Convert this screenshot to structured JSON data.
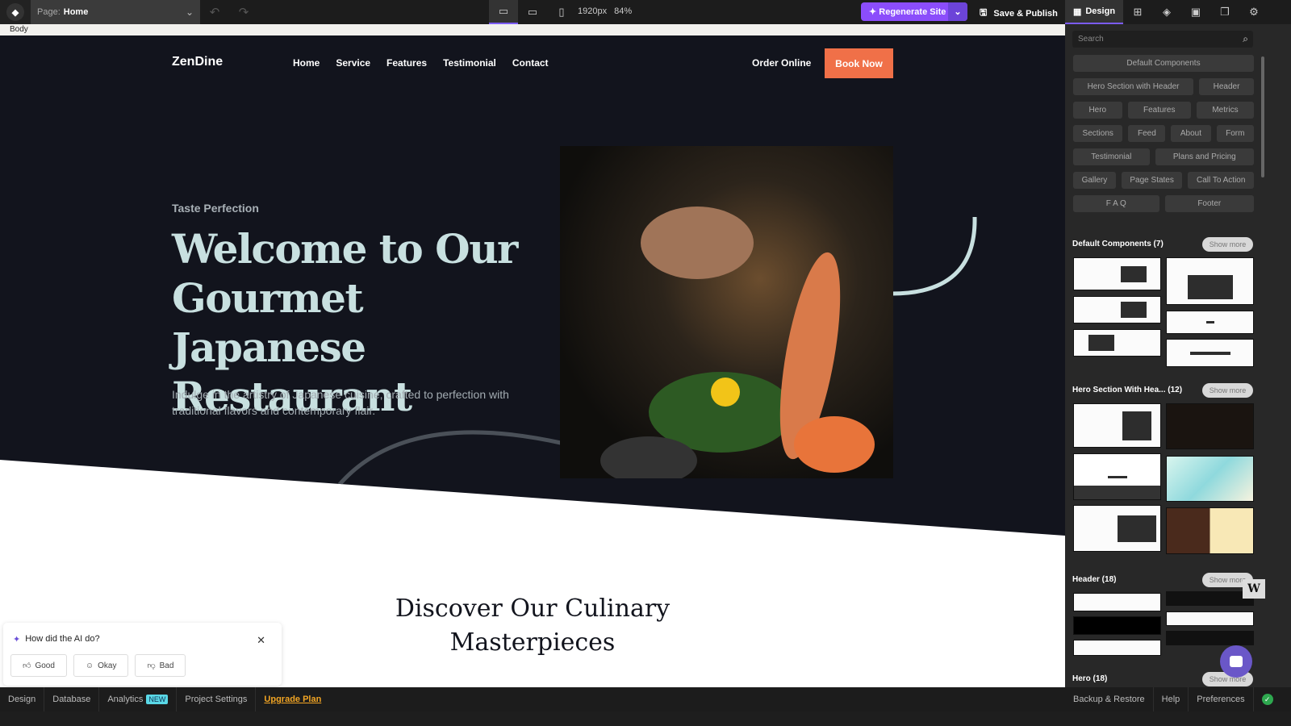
{
  "topbar": {
    "page_label": "Page:",
    "page_value": "Home",
    "viewport": "1920px",
    "zoom": "84%",
    "regenerate": "Regenerate Site",
    "save_publish": "Save & Publish",
    "design_tab": "Design"
  },
  "breadcrumb": "Body",
  "site": {
    "brand": "ZenDine",
    "nav": [
      "Home",
      "Service",
      "Features",
      "Testimonial",
      "Contact"
    ],
    "order": "Order Online",
    "book": "Book Now",
    "tagline": "Taste Perfection",
    "headline": "Welcome to Our Gourmet Japanese Restaurant",
    "subtext": "Indulge in the artistry of Japanese cuisine, crafted to perfection with traditional flavors and contemporary flair.",
    "section2": "Discover Our Culinary Masterpieces",
    "colors": {
      "dark": "#12141d",
      "accent": "#f07048",
      "headline": "#c8e0e0"
    }
  },
  "feedback": {
    "title": "How did the AI do?",
    "good": "Good",
    "okay": "Okay",
    "bad": "Bad"
  },
  "bottombar": {
    "items": [
      "Design",
      "Database",
      "Analytics",
      "Project Settings"
    ],
    "new_badge": "NEW",
    "upgrade": "Upgrade Plan",
    "right": [
      "Backup & Restore",
      "Help",
      "Preferences"
    ]
  },
  "panel": {
    "search_placeholder": "Search",
    "chips": [
      "Default Components",
      "Hero Section with Header",
      "Header",
      "Hero",
      "Features",
      "Metrics",
      "Sections",
      "Feed",
      "About",
      "Form",
      "Testimonial",
      "Plans and Pricing",
      "Gallery",
      "Page States",
      "Call To Action",
      "F A Q",
      "Footer"
    ],
    "sections": [
      {
        "title": "Default Components (7)"
      },
      {
        "title": "Hero Section With Hea... (12)"
      },
      {
        "title": "Header (18)"
      },
      {
        "title": "Hero (18)"
      }
    ],
    "show_more": "Show more"
  }
}
